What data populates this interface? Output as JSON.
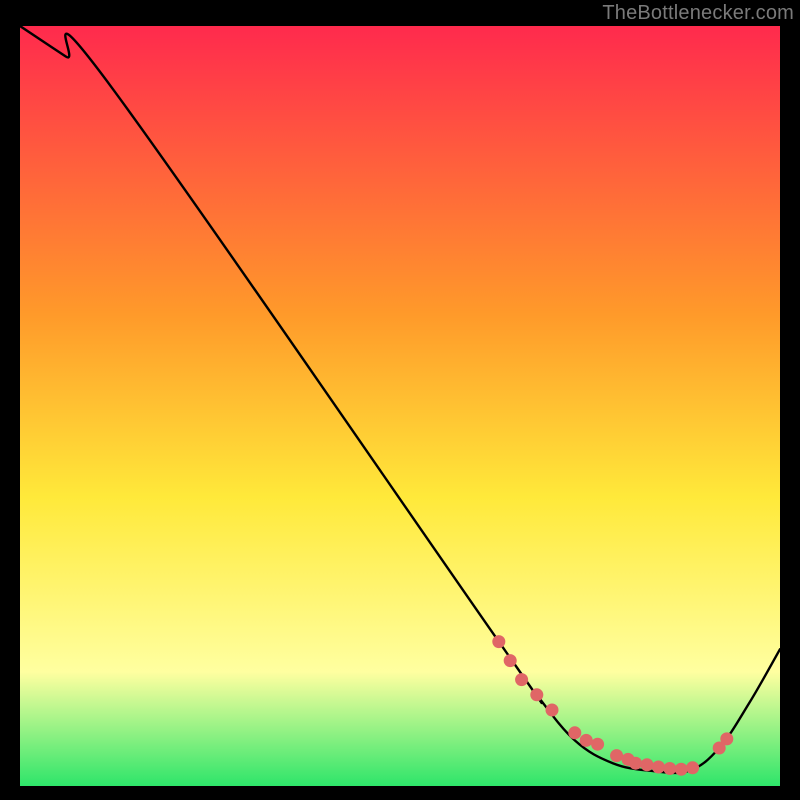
{
  "attribution": "TheBottlenecker.com",
  "colors": {
    "bg_black": "#000000",
    "grad_top": "#ff2a4d",
    "grad_orange": "#ff9a2a",
    "grad_yellow": "#ffe93a",
    "grad_pale_yellow": "#ffffa0",
    "grad_green": "#2ee56a",
    "curve": "#000000",
    "marker": "#e06666"
  },
  "chart_data": {
    "type": "line",
    "title": "",
    "xlabel": "",
    "ylabel": "",
    "xlim": [
      0,
      100
    ],
    "ylim": [
      0,
      100
    ],
    "curve": {
      "x": [
        0,
        6,
        12,
        63,
        68,
        73,
        78,
        83,
        88,
        92,
        96,
        100
      ],
      "y": [
        100,
        96,
        92,
        19,
        12,
        6,
        3,
        2,
        2,
        5,
        11,
        18
      ]
    },
    "markers": {
      "x": [
        63,
        64.5,
        66,
        68,
        70,
        73,
        74.5,
        76,
        78.5,
        80,
        81,
        82.5,
        84,
        85.5,
        87,
        88.5,
        92,
        93
      ],
      "y": [
        19,
        16.5,
        14,
        12,
        10,
        7,
        6,
        5.5,
        4,
        3.5,
        3,
        2.8,
        2.5,
        2.3,
        2.2,
        2.4,
        5,
        6.2
      ]
    }
  }
}
